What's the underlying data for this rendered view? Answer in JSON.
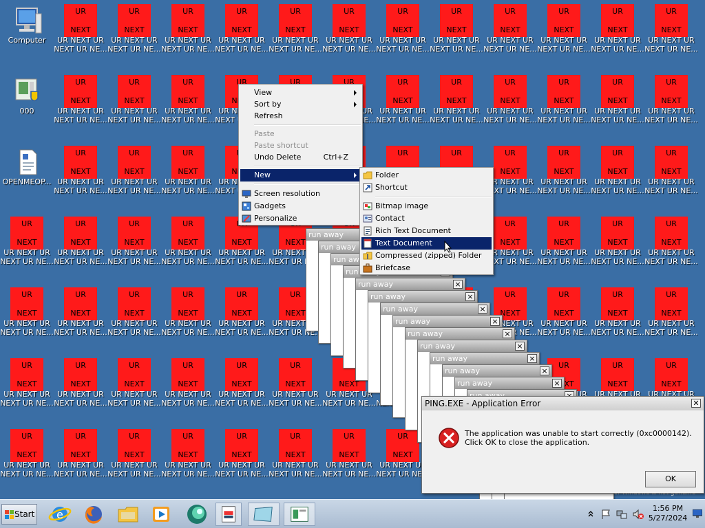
{
  "desktop": {
    "system_icons": [
      {
        "label": "Computer"
      },
      {
        "label": "000"
      },
      {
        "label": "OPENMEOP..."
      }
    ],
    "ur_icon": {
      "top_text": "UR",
      "bottom_text": "NEXT",
      "label_line1": "UR NEXT UR",
      "label_line2": "NEXT UR NE..."
    }
  },
  "context_menu": {
    "items": [
      {
        "label": "View",
        "submenu": true
      },
      {
        "label": "Sort by",
        "submenu": true
      },
      {
        "label": "Refresh"
      },
      {
        "label": "Paste",
        "disabled": true
      },
      {
        "label": "Paste shortcut",
        "disabled": true
      },
      {
        "label": "Undo Delete",
        "shortcut": "Ctrl+Z"
      },
      {
        "label": "New",
        "submenu": true,
        "selected": true
      },
      {
        "label": "Screen resolution"
      },
      {
        "label": "Gadgets"
      },
      {
        "label": "Personalize"
      }
    ]
  },
  "new_submenu": {
    "items": [
      {
        "label": "Folder"
      },
      {
        "label": "Shortcut"
      },
      {
        "label": "Bitmap image"
      },
      {
        "label": "Contact"
      },
      {
        "label": "Rich Text Document"
      },
      {
        "label": "Text Document",
        "selected": true
      },
      {
        "label": "Compressed (zipped) Folder"
      },
      {
        "label": "Briefcase"
      }
    ]
  },
  "run_away_windows": {
    "title": "run away",
    "count": 17
  },
  "error_dialog": {
    "title": "PING.EXE - Application Error",
    "message": "The application was unable to start correctly (0xc0000142). Click OK to close the application.",
    "ok_label": "OK",
    "close_label": "✕"
  },
  "watermark": "This copy of Windows is not genuine",
  "taskbar": {
    "start_label": "Start",
    "time": "1:56 PM",
    "date": "5/27/2024"
  },
  "colors": {
    "desktop": "#3a6ea5",
    "ur_red": "#ff1a1a",
    "menu_highlight": "#0a246a"
  }
}
